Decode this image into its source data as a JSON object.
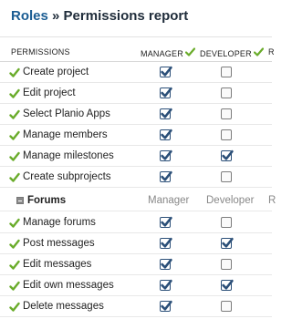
{
  "breadcrumb": {
    "parent": "Roles",
    "separator": " » ",
    "current": "Permissions report"
  },
  "columns": {
    "permissions": "PERMISSIONS",
    "manager": "MANAGER",
    "developer": "DEVELOPER",
    "extra": "R"
  },
  "colors": {
    "accent_link": "#1b5d93",
    "check_green": "#6aac2b",
    "checkbox_checked": "#2b4f78"
  },
  "project_permissions": [
    {
      "label": "Create project",
      "manager": true,
      "developer": false
    },
    {
      "label": "Edit project",
      "manager": true,
      "developer": false
    },
    {
      "label": "Select Planio Apps",
      "manager": true,
      "developer": false
    },
    {
      "label": "Manage members",
      "manager": true,
      "developer": false
    },
    {
      "label": "Manage milestones",
      "manager": true,
      "developer": true
    },
    {
      "label": "Create subprojects",
      "manager": true,
      "developer": false
    }
  ],
  "forums": {
    "title": "Forums",
    "manager_label": "Manager",
    "developer_label": "Developer",
    "extra_label": "R",
    "permissions": [
      {
        "label": "Manage forums",
        "manager": true,
        "developer": false
      },
      {
        "label": "Post messages",
        "manager": true,
        "developer": true
      },
      {
        "label": "Edit messages",
        "manager": true,
        "developer": false
      },
      {
        "label": "Edit own messages",
        "manager": true,
        "developer": true
      },
      {
        "label": "Delete messages",
        "manager": true,
        "developer": false
      }
    ]
  }
}
